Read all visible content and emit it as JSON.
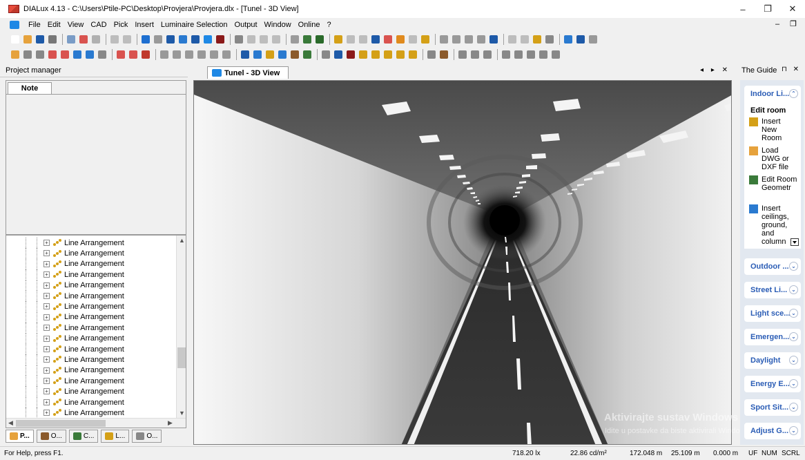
{
  "window": {
    "title": "DIALux 4.13 - C:\\Users\\Ptile-PC\\Desktop\\Provjera\\Provjera.dlx - [Tunel - 3D View]",
    "controls": [
      "–",
      "❐",
      "✕"
    ],
    "mdi_controls": "– ❐"
  },
  "menu": [
    "File",
    "Edit",
    "View",
    "CAD",
    "Pick",
    "Insert",
    "Luminaire Selection",
    "Output",
    "Window",
    "Online",
    "?"
  ],
  "toolbar1_colors": [
    "#ffffff",
    "#e6a23c",
    "#1e5aa8",
    "#777777",
    "#7a9cc6",
    "#d9534f",
    "#b0b0b0",
    "#bdbdbd",
    "#bdbdbd",
    "#1e6fd0",
    "#999999",
    "#1e5aa8",
    "#2a7ad0",
    "#1e5aa8",
    "#1e88e5",
    "#8b1a1a",
    "#888888",
    "#bdbdbd",
    "#bdbdbd",
    "#bdbdbd",
    "#9b9b9b",
    "#3a7a3a",
    "#2a6a2a",
    "#d4a017",
    "#bdbdbd",
    "#bdbdbd",
    "#1e5aa8",
    "#d9534f",
    "#e08a1e",
    "#bdbdbd",
    "#d4a017",
    "#999999",
    "#999999",
    "#999999",
    "#999999",
    "#1e5aa8",
    "#bdbdbd",
    "#bdbdbd",
    "#d4a017",
    "#888888",
    "#2a7ad0",
    "#1e5aa8",
    "#999999"
  ],
  "toolbar2_colors": [
    "#e6a23c",
    "#888888",
    "#888888",
    "#d9534f",
    "#d9534f",
    "#2a7ad0",
    "#2a7ad0",
    "#888888",
    "#d9534f",
    "#d9534f",
    "#c0392b",
    "#999999",
    "#999999",
    "#999999",
    "#999999",
    "#999999",
    "#999999",
    "#1e5aa8",
    "#2a7ad0",
    "#d4a017",
    "#2a7ad0",
    "#8b5a2b",
    "#3a7a3a",
    "#888888",
    "#1e5aa8",
    "#8b1a1a",
    "#d4a017",
    "#d4a017",
    "#d4a017",
    "#d4a017",
    "#d4a017",
    "#888888",
    "#8b5a2b",
    "#888888",
    "#888888",
    "#888888",
    "#888888",
    "#888888",
    "#888888",
    "#888888",
    "#888888"
  ],
  "project_manager": {
    "title": "Project manager",
    "note_tab": "Note",
    "tree_items": [
      "Line Arrangement",
      "Line Arrangement",
      "Line Arrangement",
      "Line Arrangement",
      "Line Arrangement",
      "Line Arrangement",
      "Line Arrangement",
      "Line Arrangement",
      "Line Arrangement",
      "Line Arrangement",
      "Line Arrangement",
      "Line Arrangement",
      "Line Arrangement",
      "Line Arrangement",
      "Line Arrangement",
      "Line Arrangement",
      "Line Arrangement"
    ],
    "bottom_tabs": [
      {
        "label": "P...",
        "color": "#e6a23c"
      },
      {
        "label": "O...",
        "color": "#8b5a2b"
      },
      {
        "label": "C...",
        "color": "#3a7a3a"
      },
      {
        "label": "L...",
        "color": "#d4a017"
      },
      {
        "label": "O...",
        "color": "#888888"
      }
    ]
  },
  "document": {
    "tab_title": "Tunel - 3D View",
    "nav": "◂ ▸ ✕"
  },
  "watermark": {
    "line1": "Aktivirajte sustav Windows",
    "line2": "Idite u postavke da biste aktivirali Windows."
  },
  "guide": {
    "title": "The Guide",
    "pin": "⊓ ✕",
    "expanded_section": "Indoor Li...",
    "edit_title": "Edit room",
    "items": [
      {
        "label": "Insert New Room",
        "icon_color": "#d4a017"
      },
      {
        "label": "Load DWG or DXF file",
        "icon_color": "#e6a23c"
      },
      {
        "label": "Edit Room Geometr",
        "icon_color": "#3a7a3a"
      },
      {
        "label": "Insert ceilings, ground, and column",
        "icon_color": "#2a7ad0"
      }
    ],
    "sections": [
      "Outdoor ...",
      "Street Li...",
      "Light sce...",
      "Emergen...",
      "Daylight",
      "Energy E...",
      "Sport Sit...",
      "Adjust G..."
    ],
    "chevron_up": "⌃",
    "chevron_down": "⌄"
  },
  "status": {
    "help": "For Help, press F1.",
    "illuminance": "718.20 lx",
    "luminance": "22.86 cd/m²",
    "x": "172.048 m",
    "y": "25.109 m",
    "z": "0.000 m",
    "uf": "UF",
    "num": "NUM",
    "scrl": "SCRL"
  }
}
